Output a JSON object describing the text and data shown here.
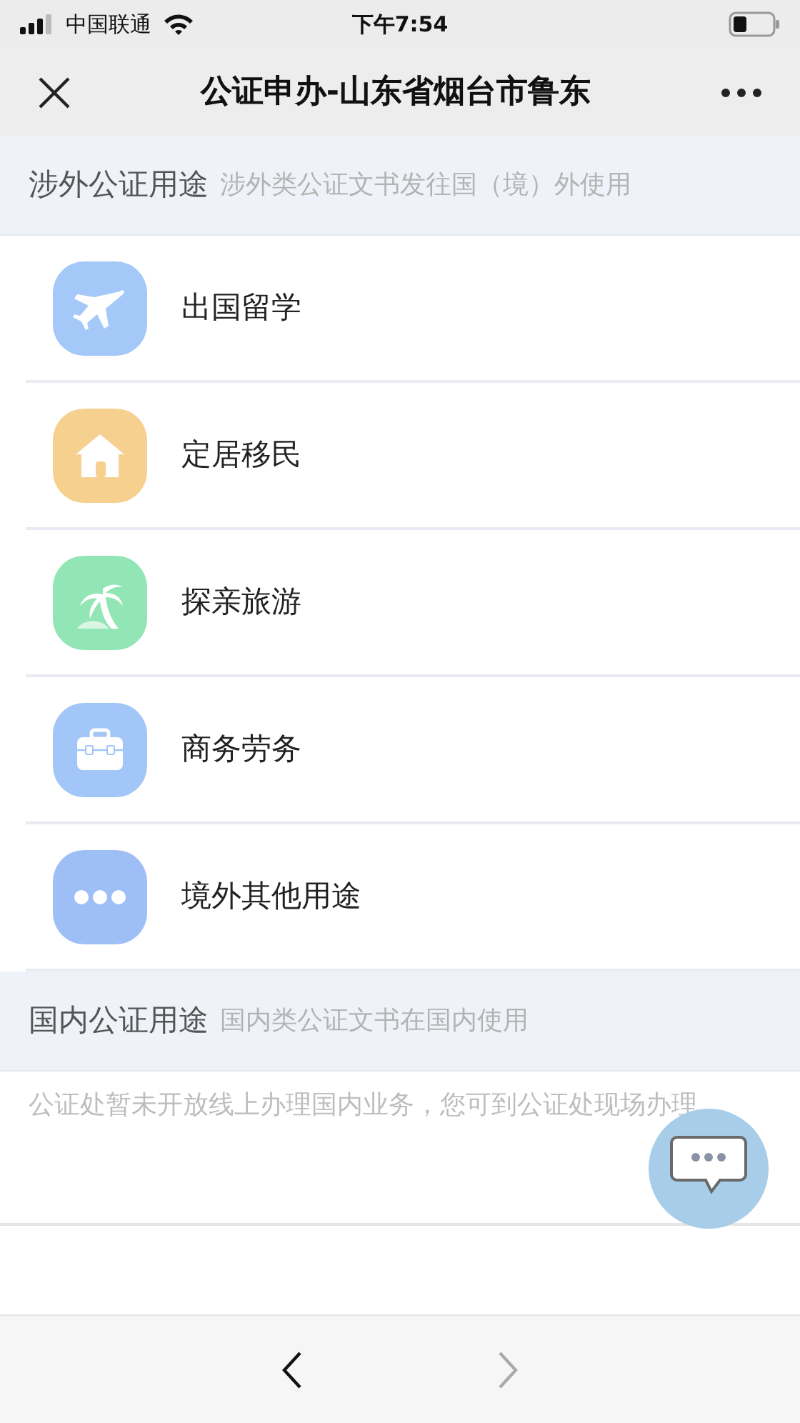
{
  "status_bar": {
    "carrier": "中国联通",
    "time": "下午7:54"
  },
  "header": {
    "title": "公证申办-山东省烟台市鲁东"
  },
  "sections": [
    {
      "title": "涉外公证用途",
      "subtitle": "涉外类公证文书发往国（境）外使用",
      "items": [
        {
          "label": "出国留学",
          "color": "#a4c8f8"
        },
        {
          "label": "定居移民",
          "color": "#f6d08e"
        },
        {
          "label": "探亲旅游",
          "color": "#92e6b5"
        },
        {
          "label": "商务劳务",
          "color": "#a2c6f8"
        },
        {
          "label": "境外其他用途",
          "color": "#9ebff6"
        }
      ]
    },
    {
      "title": "国内公证用途",
      "subtitle": "国内类公证文书在国内使用",
      "notice": "公证处暂未开放线上办理国内业务，您可到公证处现场办理"
    }
  ],
  "bottom_nav": {
    "back_disabled": false,
    "forward_disabled": true
  }
}
